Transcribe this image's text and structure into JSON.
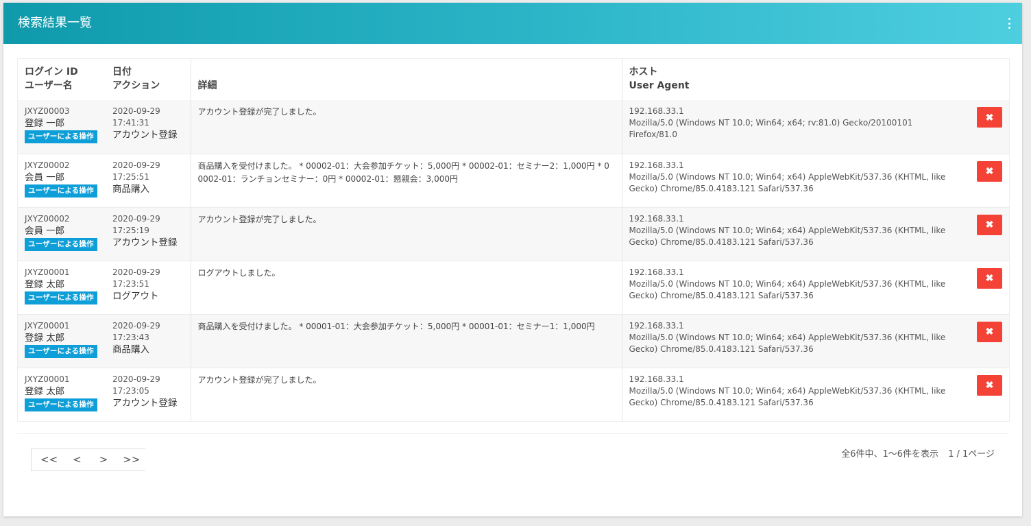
{
  "header": {
    "title": "検索結果一覧"
  },
  "columns": {
    "login_id": "ログイン ID",
    "user_name": "ユーザー名",
    "date": "日付",
    "action": "アクション",
    "detail": "詳細",
    "host": "ホスト",
    "user_agent": "User Agent"
  },
  "rows": [
    {
      "login_id": "JXYZ00003",
      "user_name": "登録 一郎",
      "badge": "ユーザーによる操作",
      "date": "2020-09-29",
      "time": "17:41:31",
      "action": "アカウント登録",
      "detail": "アカウント登録が完了しました。",
      "host": "192.168.33.1",
      "user_agent": "Mozilla/5.0 (Windows NT 10.0; Win64; x64; rv:81.0) Gecko/20100101 Firefox/81.0"
    },
    {
      "login_id": "JXYZ00002",
      "user_name": "会員 一郎",
      "badge": "ユーザーによる操作",
      "date": "2020-09-29",
      "time": "17:25:51",
      "action": "商品購入",
      "detail": "商品購入を受付けました。 * 00002-01：大会参加チケット：5,000円 * 00002-01：セミナー2：1,000円 * 00002-01：ランチョンセミナー：0円 * 00002-01：懇親会：3,000円",
      "host": "192.168.33.1",
      "user_agent": "Mozilla/5.0 (Windows NT 10.0; Win64; x64) AppleWebKit/537.36 (KHTML, like Gecko) Chrome/85.0.4183.121 Safari/537.36"
    },
    {
      "login_id": "JXYZ00002",
      "user_name": "会員 一郎",
      "badge": "ユーザーによる操作",
      "date": "2020-09-29",
      "time": "17:25:19",
      "action": "アカウント登録",
      "detail": "アカウント登録が完了しました。",
      "host": "192.168.33.1",
      "user_agent": "Mozilla/5.0 (Windows NT 10.0; Win64; x64) AppleWebKit/537.36 (KHTML, like Gecko) Chrome/85.0.4183.121 Safari/537.36"
    },
    {
      "login_id": "JXYZ00001",
      "user_name": "登録 太郎",
      "badge": "ユーザーによる操作",
      "date": "2020-09-29",
      "time": "17:23:51",
      "action": "ログアウト",
      "detail": "ログアウトしました。",
      "host": "192.168.33.1",
      "user_agent": "Mozilla/5.0 (Windows NT 10.0; Win64; x64) AppleWebKit/537.36 (KHTML, like Gecko) Chrome/85.0.4183.121 Safari/537.36"
    },
    {
      "login_id": "JXYZ00001",
      "user_name": "登録 太郎",
      "badge": "ユーザーによる操作",
      "date": "2020-09-29",
      "time": "17:23:43",
      "action": "商品購入",
      "detail": "商品購入を受付けました。 * 00001-01：大会参加チケット：5,000円 * 00001-01：セミナー1：1,000円",
      "host": "192.168.33.1",
      "user_agent": "Mozilla/5.0 (Windows NT 10.0; Win64; x64) AppleWebKit/537.36 (KHTML, like Gecko) Chrome/85.0.4183.121 Safari/537.36"
    },
    {
      "login_id": "JXYZ00001",
      "user_name": "登録 太郎",
      "badge": "ユーザーによる操作",
      "date": "2020-09-29",
      "time": "17:23:05",
      "action": "アカウント登録",
      "detail": "アカウント登録が完了しました。",
      "host": "192.168.33.1",
      "user_agent": "Mozilla/5.0 (Windows NT 10.0; Win64; x64) AppleWebKit/537.36 (KHTML, like Gecko) Chrome/85.0.4183.121 Safari/537.36"
    }
  ],
  "delete_icon_glyph": "✖",
  "pager": {
    "first": "<<",
    "prev": "<",
    "next": ">",
    "last": ">>"
  },
  "summary": {
    "count": "全6件中、1〜6件を表示",
    "page": "1 / 1ページ"
  },
  "colors": {
    "header_start": "#0f9aac",
    "header_end": "#4ecfe0",
    "badge": "#0f9fd8",
    "delete": "#f44336"
  },
  "icons": {
    "menu": "kebab-menu-icon",
    "delete": "close-icon"
  }
}
